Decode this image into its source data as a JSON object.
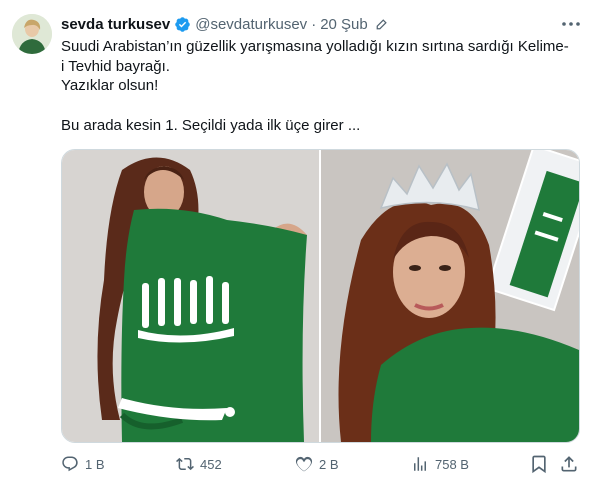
{
  "author": {
    "name": "sevda turkusev",
    "handle": "@sevdaturkusev",
    "separator": "·",
    "date": "20 Şub"
  },
  "tweet": {
    "line1": "Suudi Arabistan’ın güzellik yarışmasına yolladığı kızın sırtına sardığı Kelime-",
    "line2": "i Tevhid bayrağı.",
    "line3": "Yazıklar olsun!",
    "line4": "",
    "line5": "Bu arada kesin 1. Seçildi yada ilk üçe girer ..."
  },
  "actions": {
    "replies": "1 B",
    "retweets": "452",
    "likes": "2 B",
    "views": "758 B"
  },
  "icons": [
    "verified-badge-icon",
    "edit-icon",
    "more-icon",
    "reply-icon",
    "retweet-icon",
    "like-icon",
    "views-icon",
    "bookmark-icon",
    "share-icon"
  ],
  "colors": {
    "text": "#0f1419",
    "secondary": "#536471",
    "verified": "#1d9bf0",
    "flag_green": "#1f7a3a",
    "border": "#cfd9de"
  }
}
